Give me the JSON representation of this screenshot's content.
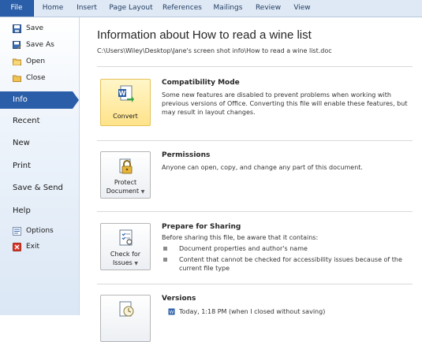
{
  "ribbon": {
    "tabs": [
      "File",
      "Home",
      "Insert",
      "Page Layout",
      "References",
      "Mailings",
      "Review",
      "View"
    ]
  },
  "sidebar": {
    "items": [
      {
        "label": "Save",
        "icon": "save-icon"
      },
      {
        "label": "Save As",
        "icon": "save-as-icon"
      },
      {
        "label": "Open",
        "icon": "open-folder-icon"
      },
      {
        "label": "Close",
        "icon": "close-folder-icon"
      },
      {
        "label": "Info"
      },
      {
        "label": "Recent"
      },
      {
        "label": "New"
      },
      {
        "label": "Print"
      },
      {
        "label": "Save & Send"
      },
      {
        "label": "Help"
      },
      {
        "label": "Options",
        "icon": "options-icon"
      },
      {
        "label": "Exit",
        "icon": "exit-icon"
      }
    ],
    "selected": "Info"
  },
  "main": {
    "title": "Information about How to read a wine list",
    "path": "C:\\Users\\Wiley\\Desktop\\Jane's screen shot info\\How to read a wine list.doc",
    "sections": [
      {
        "button": "Convert",
        "title": "Compatibility Mode",
        "text": "Some new features are disabled to prevent problems when working with previous versions of Office. Converting this file will enable these features, but may result in layout changes."
      },
      {
        "button_line1": "Protect",
        "button_line2": "Document",
        "title": "Permissions",
        "text": "Anyone can open, copy, and change any part of this document."
      },
      {
        "button_line1": "Check for",
        "button_line2": "Issues",
        "title": "Prepare for Sharing",
        "text": "Before sharing this file, be aware that it contains:",
        "bullets": [
          "Document properties and author's name",
          "Content that cannot be checked for accessibility issues because of the current file type"
        ]
      },
      {
        "title": "Versions",
        "text": "Today, 1:18 PM (when I closed without saving)"
      }
    ]
  },
  "colors": {
    "accent": "#2a5ea8",
    "highlight": "#ffe38a"
  }
}
